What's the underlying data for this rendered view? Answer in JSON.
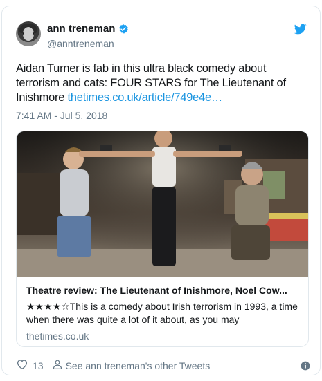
{
  "tweet": {
    "display_name": "ann treneman",
    "handle": "@anntreneman",
    "text_plain": "Aidan Turner is fab in this ultra black comedy about terrorism and cats: FOUR STARS for  The Lieutenant of Inishmore ",
    "text_link": "thetimes.co.uk/article/749e4e…",
    "timestamp": "7:41 AM - Jul 5, 2018"
  },
  "card": {
    "title": "Theatre review: The Lieutenant of Inishmore, Noel Cow...",
    "description": "★★★★☆This is a comedy about Irish terrorism in 1993, a time when there was quite a lot of it about, as you may",
    "domain": "thetimes.co.uk"
  },
  "footer": {
    "like_count": "13",
    "other_tweets_label": "See ann treneman's other Tweets"
  },
  "colors": {
    "link": "#1b95e0",
    "verified": "#1da1f2",
    "muted": "#657786"
  },
  "icons": {
    "verified": "verified-badge-icon",
    "bird": "twitter-bird-icon",
    "like": "heart-icon",
    "person": "person-icon",
    "info": "info-icon"
  }
}
